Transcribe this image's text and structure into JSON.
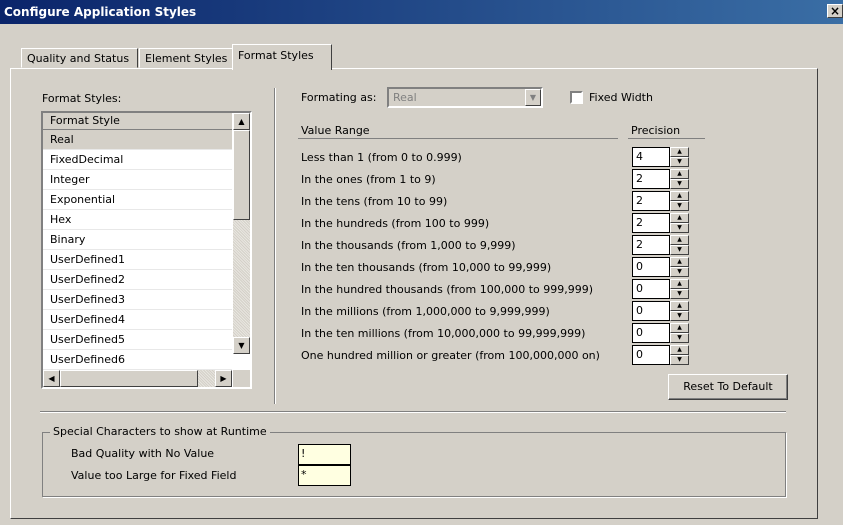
{
  "window": {
    "title": "Configure Application Styles",
    "close_glyph": "×"
  },
  "tabs": [
    {
      "label": "Quality and Status"
    },
    {
      "label": "Element Styles"
    },
    {
      "label": "Format Styles"
    }
  ],
  "left": {
    "label": "Format Styles:",
    "list_header": "Format Style",
    "items": [
      "Real",
      "FixedDecimal",
      "Integer",
      "Exponential",
      "Hex",
      "Binary",
      "UserDefined1",
      "UserDefined2",
      "UserDefined3",
      "UserDefined4",
      "UserDefined5",
      "UserDefined6"
    ],
    "selected": "Real"
  },
  "format": {
    "label": "Formating as:",
    "value": "Real",
    "fixed_width_label": "Fixed Width",
    "fixed_width_checked": false
  },
  "ranges": {
    "col_value": "Value Range",
    "col_precision": "Precision",
    "rows": [
      {
        "label": "Less than 1 (from 0 to 0.999)",
        "precision": "4"
      },
      {
        "label": "In the ones (from 1 to 9)",
        "precision": "2"
      },
      {
        "label": "In the tens (from 10 to 99)",
        "precision": "2"
      },
      {
        "label": "In the hundreds (from 100 to 999)",
        "precision": "2"
      },
      {
        "label": "In the thousands (from 1,000 to 9,999)",
        "precision": "2"
      },
      {
        "label": "In the ten thousands (from 10,000 to 99,999)",
        "precision": "0"
      },
      {
        "label": "In the hundred thousands (from 100,000 to 999,999)",
        "precision": "0"
      },
      {
        "label": "In the millions (from 1,000,000 to 9,999,999)",
        "precision": "0"
      },
      {
        "label": "In the ten millions (from 10,000,000 to 99,999,999)",
        "precision": "0"
      },
      {
        "label": "One hundred million or greater (from 100,000,000 on)",
        "precision": "0"
      }
    ]
  },
  "reset_label": "Reset To Default",
  "special": {
    "title": "Special Characters to show at Runtime",
    "bad_quality_label": "Bad Quality with No Value",
    "bad_quality_value": "!",
    "too_large_label": "Value too Large for Fixed Field",
    "too_large_value": "*"
  }
}
